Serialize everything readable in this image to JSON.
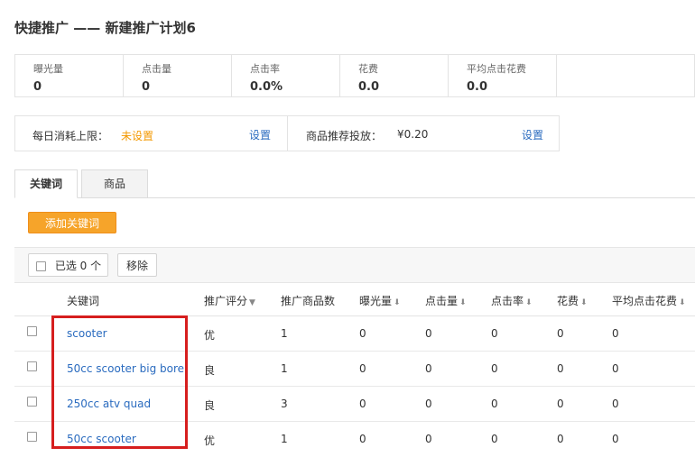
{
  "page": {
    "title": "快捷推广 —— 新建推广计划6"
  },
  "stats": [
    {
      "label": "曝光量",
      "value": "0"
    },
    {
      "label": "点击量",
      "value": "0"
    },
    {
      "label": "点击率",
      "value": "0.0%"
    },
    {
      "label": "花费",
      "value": "0.0"
    },
    {
      "label": "平均点击花费",
      "value": "0.0"
    }
  ],
  "budget": {
    "daily_label": "每日消耗上限：",
    "daily_value": "未设置",
    "daily_set": "设置",
    "product_label": "商品推荐投放：",
    "product_value": "¥0.20",
    "product_set": "设置"
  },
  "tabs": [
    {
      "label": "关键词"
    },
    {
      "label": "商品"
    }
  ],
  "add_keyword_button": "添加关键词",
  "toolbar": {
    "selected_label": "已选 0 个",
    "remove_label": "移除"
  },
  "table": {
    "headers": [
      "关键词",
      "推广评分",
      "推广商品数",
      "曝光量",
      "点击量",
      "点击率",
      "花费",
      "平均点击花费"
    ],
    "rows": [
      {
        "keyword": "scooter",
        "score": "优",
        "products": "1",
        "impressions": "0",
        "clicks": "0",
        "ctr": "0",
        "cost": "0",
        "avg_cpc": "0"
      },
      {
        "keyword": "50cc scooter big bore",
        "score": "良",
        "products": "1",
        "impressions": "0",
        "clicks": "0",
        "ctr": "0",
        "cost": "0",
        "avg_cpc": "0"
      },
      {
        "keyword": "250cc atv quad",
        "score": "良",
        "products": "3",
        "impressions": "0",
        "clicks": "0",
        "ctr": "0",
        "cost": "0",
        "avg_cpc": "0"
      },
      {
        "keyword": "50cc scooter",
        "score": "优",
        "products": "1",
        "impressions": "0",
        "clicks": "0",
        "ctr": "0",
        "cost": "0",
        "avg_cpc": "0"
      }
    ]
  },
  "colors": {
    "link": "#2a6bbf",
    "accent_orange": "#f6a42a",
    "not_set_orange": "#f39800",
    "highlight_red": "#d61e1e"
  }
}
